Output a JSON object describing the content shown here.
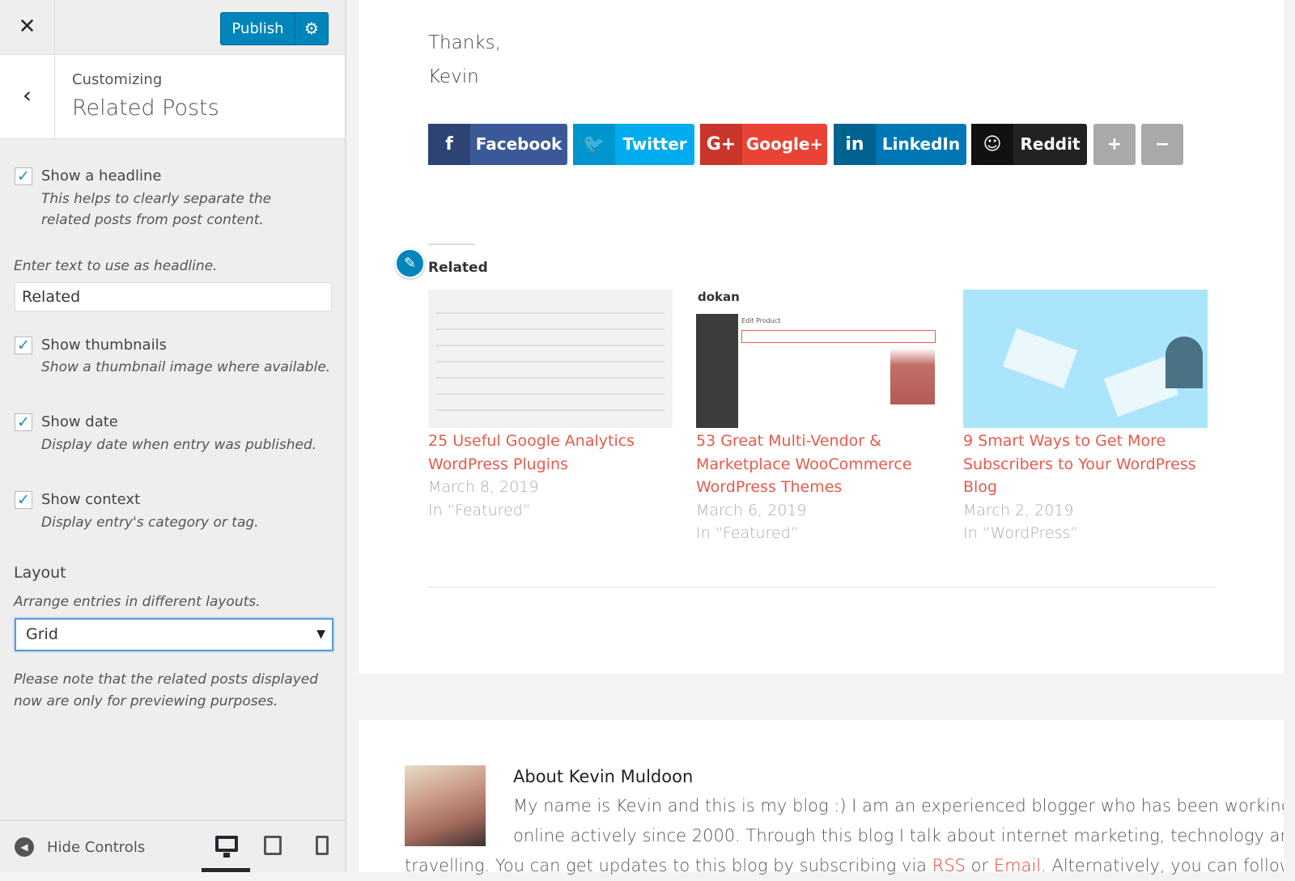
{
  "header": {
    "publish_label": "Publish",
    "close_icon": "close-icon",
    "settings_icon": "gear-icon"
  },
  "panel": {
    "breadcrumb": "Customizing",
    "title": "Related Posts"
  },
  "options": [
    {
      "label": "Show a headline",
      "description": "This helps to clearly separate the related posts from post content.",
      "checked": true
    },
    {
      "label": "Show thumbnails",
      "description": "Show a thumbnail image where available.",
      "checked": true
    },
    {
      "label": "Show date",
      "description": "Display date when entry was published.",
      "checked": true
    },
    {
      "label": "Show context",
      "description": "Display entry's category or tag.",
      "checked": true
    }
  ],
  "headline": {
    "prompt": "Enter text to use as headline.",
    "value": "Related"
  },
  "layout": {
    "title": "Layout",
    "description": "Arrange entries in different layouts.",
    "selected": "Grid",
    "note": "Please note that the related posts displayed now are only for previewing purposes."
  },
  "footer": {
    "hide_controls": "Hide Controls",
    "active_device": "desktop"
  },
  "preview": {
    "signoff": [
      "Thanks,",
      "Kevin"
    ],
    "share_buttons": [
      {
        "label": "Facebook",
        "icon": "f",
        "color": "#3b5998",
        "dark": "#2d4373"
      },
      {
        "label": "Twitter",
        "icon": "🐦",
        "color": "#00aced",
        "dark": "#0095cc"
      },
      {
        "label": "Google+",
        "icon": "G+",
        "color": "#ea4335",
        "dark": "#c9352a"
      },
      {
        "label": "LinkedIn",
        "icon": "in",
        "color": "#0077b5",
        "dark": "#00628f"
      },
      {
        "label": "Reddit",
        "icon": "☺",
        "color": "#222222",
        "dark": "#111111"
      }
    ],
    "related_heading": "Related",
    "posts": [
      {
        "title": "25 Useful Google Analytics WordPress Plugins",
        "date": "March 8, 2019",
        "context": "In “Featured”"
      },
      {
        "title": "53 Great Multi-Vendor & Marketplace WooCommerce WordPress Themes",
        "date": "March 6, 2019",
        "context": "In “Featured”",
        "thumb_brand": "dokan",
        "thumb_heading": "Edit Product"
      },
      {
        "title": "9 Smart Ways to Get More Subscribers to Your WordPress Blog",
        "date": "March 2, 2019",
        "context": "In “WordPress”"
      }
    ],
    "about": {
      "heading": "About Kevin Muldoon",
      "line1": "My name is Kevin and this is my blog :) I am an experienced blogger who has been working",
      "line2": "online actively since 2000. Through this blog I talk about internet marketing, technology and",
      "line3_a": "travelling. You can get updates to this blog by subscribing via ",
      "rss": "RSS",
      "or": " or ",
      "email": "Email",
      "line3_b": ". Alternatively, you can follow me"
    }
  }
}
